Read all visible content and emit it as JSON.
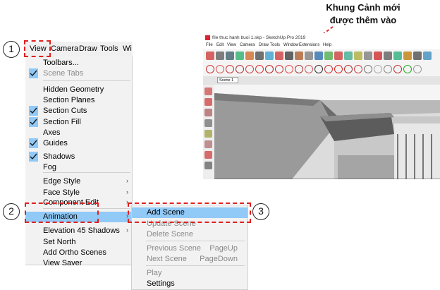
{
  "caption": {
    "line1": "Khung Cảnh mới",
    "line2": "được thêm vào"
  },
  "steps": [
    "1",
    "2",
    "3"
  ],
  "menubar": [
    "View",
    "Camera",
    "Draw",
    "Tools",
    "Wi"
  ],
  "view_menu": [
    {
      "label": "Toolbars...",
      "checked": false,
      "disabled": false,
      "submenu": false
    },
    {
      "label": "Scene Tabs",
      "checked": true,
      "disabled": true,
      "submenu": false
    },
    {
      "label": "Hidden Geometry",
      "checked": false,
      "disabled": false,
      "submenu": false
    },
    {
      "label": "Section Planes",
      "checked": false,
      "disabled": false,
      "submenu": false
    },
    {
      "label": "Section Cuts",
      "checked": true,
      "disabled": false,
      "submenu": false
    },
    {
      "label": "Section Fill",
      "checked": true,
      "disabled": false,
      "submenu": false
    },
    {
      "label": "Axes",
      "checked": false,
      "disabled": false,
      "submenu": false
    },
    {
      "label": "Guides",
      "checked": true,
      "disabled": false,
      "submenu": false
    },
    {
      "label": "Shadows",
      "checked": true,
      "disabled": false,
      "submenu": false
    },
    {
      "label": "Fog",
      "checked": false,
      "disabled": false,
      "submenu": false
    },
    {
      "label": "Edge Style",
      "checked": false,
      "disabled": false,
      "submenu": true
    },
    {
      "label": "Face Style",
      "checked": false,
      "disabled": false,
      "submenu": true
    },
    {
      "label": "Component Edit",
      "checked": false,
      "disabled": false,
      "submenu": true
    },
    {
      "label": "Animation",
      "checked": false,
      "disabled": false,
      "submenu": true,
      "highlighted": true
    },
    {
      "label": "Elevation 45 Shadows",
      "checked": false,
      "disabled": false,
      "submenu": true
    },
    {
      "label": "Set North",
      "checked": false,
      "disabled": false,
      "submenu": false
    },
    {
      "label": "Add Ortho Scenes",
      "checked": false,
      "disabled": false,
      "submenu": false
    },
    {
      "label": "View Saver",
      "checked": false,
      "disabled": false,
      "submenu": false
    }
  ],
  "animation_submenu": [
    {
      "label": "Add Scene",
      "shortcut": "",
      "disabled": false,
      "highlighted": true
    },
    {
      "label": "Update Scene",
      "shortcut": "",
      "disabled": true
    },
    {
      "label": "Delete Scene",
      "shortcut": "",
      "disabled": true
    },
    {
      "label": "Previous Scene",
      "shortcut": "PageUp",
      "disabled": true
    },
    {
      "label": "Next Scene",
      "shortcut": "PageDown",
      "disabled": true
    },
    {
      "label": "Play",
      "shortcut": "",
      "disabled": true
    },
    {
      "label": "Settings",
      "shortcut": "",
      "disabled": false
    }
  ],
  "sketchup": {
    "title": "file thuc hanh buoi 1.skp - SketchUp Pro 2019",
    "menu": [
      "File",
      "Edit",
      "View",
      "Camera",
      "Draw",
      "Tools",
      "Window",
      "Extensions",
      "Help"
    ],
    "scene_tab": "Scene 1"
  },
  "colors": {
    "highlight": "#91c9f7",
    "callout": "#e02020"
  }
}
